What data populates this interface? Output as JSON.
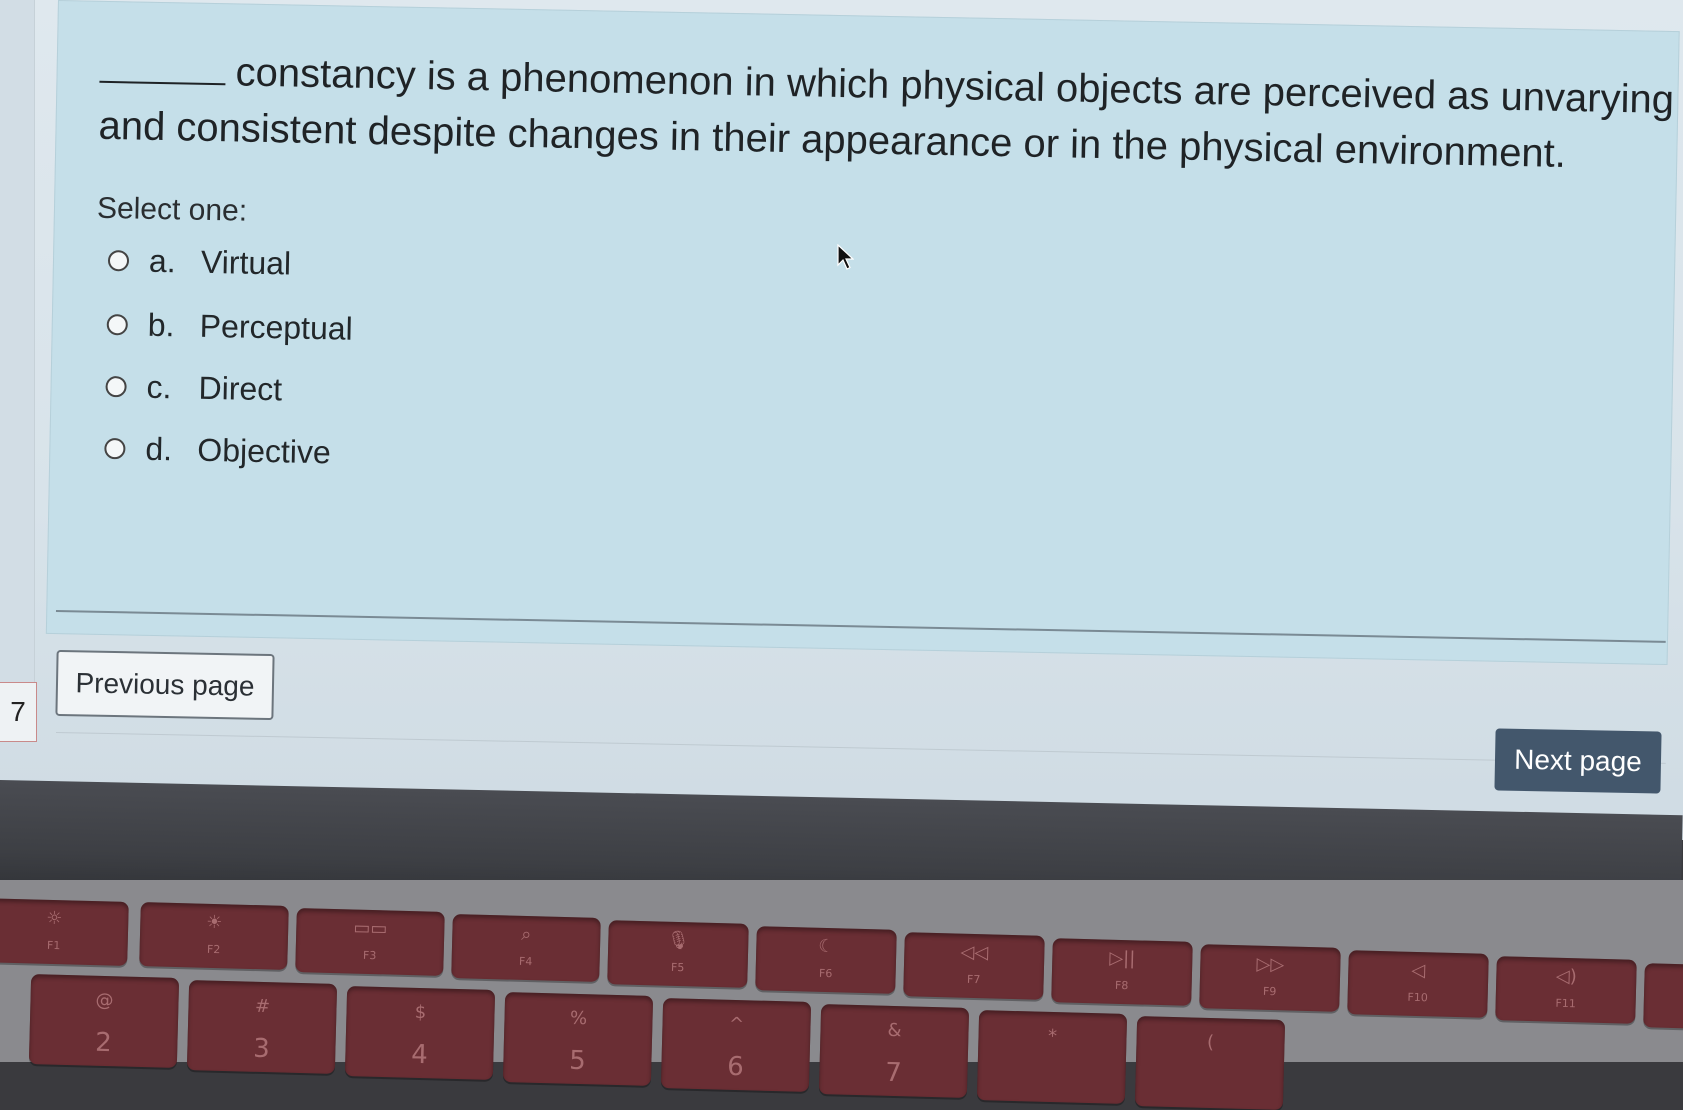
{
  "question": {
    "text": "constancy is a phenomenon in which physical objects are perceived as unvarying and consistent despite changes in their appearance or in the physical environment.",
    "prompt": "Select one:",
    "options": [
      {
        "letter": "a.",
        "label": "Virtual"
      },
      {
        "letter": "b.",
        "label": "Perceptual"
      },
      {
        "letter": "c.",
        "label": "Direct"
      },
      {
        "letter": "d.",
        "label": "Objective"
      }
    ]
  },
  "navigation": {
    "previous_label": "Previous page",
    "next_label": "Next page",
    "question_number": "7"
  },
  "keyboard": {
    "function_keys": [
      {
        "icon": "brightness-down-icon",
        "fn": "F1"
      },
      {
        "icon": "brightness-up-icon",
        "fn": "F2"
      },
      {
        "icon": "mission-control-icon",
        "fn": "F3"
      },
      {
        "icon": "search-icon",
        "fn": "F4"
      },
      {
        "icon": "microphone-icon",
        "fn": "F5"
      },
      {
        "icon": "moon-icon",
        "fn": "F6"
      },
      {
        "icon": "rewind-icon",
        "fn": "F7"
      },
      {
        "icon": "play-pause-icon",
        "fn": "F8"
      },
      {
        "icon": "fast-forward-icon",
        "fn": "F9"
      },
      {
        "icon": "mute-icon",
        "fn": "F10"
      },
      {
        "icon": "volume-down-icon",
        "fn": "F11"
      }
    ],
    "number_keys": [
      {
        "top": "@",
        "num": "2"
      },
      {
        "top": "#",
        "num": "3"
      },
      {
        "top": "$",
        "num": "4"
      },
      {
        "top": "%",
        "num": "5"
      },
      {
        "top": "^",
        "num": "6"
      },
      {
        "top": "&",
        "num": "7"
      },
      {
        "top": "*",
        "num": ""
      },
      {
        "top": "(",
        "num": ""
      }
    ]
  }
}
